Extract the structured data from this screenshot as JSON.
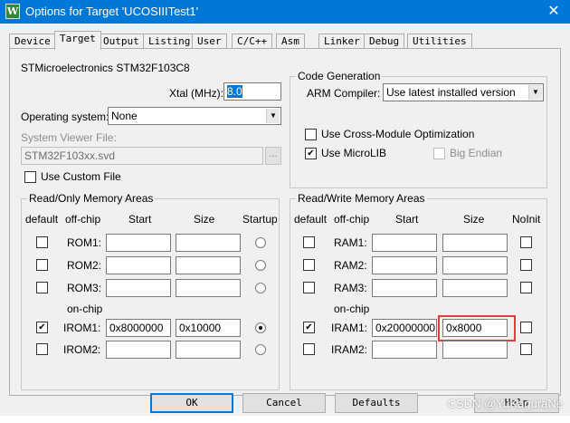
{
  "window": {
    "title": "Options for Target 'UCOSIIITest1'",
    "close_glyph": "✕",
    "app_icon_letter": "W"
  },
  "tabs": [
    "Device",
    "Target",
    "Output",
    "Listing",
    "User",
    "C/C++",
    "Asm",
    "Linker",
    "Debug",
    "Utilities"
  ],
  "active_tab": "Target",
  "device_name": "STMicroelectronics STM32F103C8",
  "xtal": {
    "label": "Xtal (MHz):",
    "value": "8.0"
  },
  "operating_system": {
    "label": "Operating system:",
    "value": "None"
  },
  "system_viewer": {
    "label": "System Viewer File:",
    "value": "STM32F103xx.svd",
    "browse_label": "..."
  },
  "use_custom_file": {
    "label": "Use Custom File",
    "checked": false
  },
  "code_generation": {
    "title": "Code Generation",
    "arm_compiler_label": "ARM Compiler:",
    "arm_compiler_value": "Use latest installed version",
    "cross_module": {
      "label": "Use Cross-Module Optimization",
      "checked": false
    },
    "microlib": {
      "label": "Use MicroLIB",
      "checked": true
    },
    "big_endian": {
      "label": "Big Endian",
      "checked": false,
      "disabled": true
    }
  },
  "rom_areas": {
    "title": "Read/Only Memory Areas",
    "headers": {
      "default": "default",
      "offchip": "off-chip",
      "start": "Start",
      "size": "Size",
      "startup": "Startup"
    },
    "onchip_label": "on-chip",
    "rows": [
      {
        "name": "ROM1:",
        "start": "",
        "size": "",
        "default": false,
        "startup": false
      },
      {
        "name": "ROM2:",
        "start": "",
        "size": "",
        "default": false,
        "startup": false
      },
      {
        "name": "ROM3:",
        "start": "",
        "size": "",
        "default": false,
        "startup": false
      },
      {
        "name": "IROM1:",
        "start": "0x8000000",
        "size": "0x10000",
        "default": true,
        "startup": true
      },
      {
        "name": "IROM2:",
        "start": "",
        "size": "",
        "default": false,
        "startup": false
      }
    ]
  },
  "ram_areas": {
    "title": "Read/Write Memory Areas",
    "headers": {
      "default": "default",
      "offchip": "off-chip",
      "start": "Start",
      "size": "Size",
      "noinit": "NoInit"
    },
    "onchip_label": "on-chip",
    "rows": [
      {
        "name": "RAM1:",
        "start": "",
        "size": "",
        "default": false,
        "noinit": false
      },
      {
        "name": "RAM2:",
        "start": "",
        "size": "",
        "default": false,
        "noinit": false
      },
      {
        "name": "RAM3:",
        "start": "",
        "size": "",
        "default": false,
        "noinit": false
      },
      {
        "name": "IRAM1:",
        "start": "0x20000000",
        "size": "0x8000",
        "default": true,
        "noinit": false
      },
      {
        "name": "IRAM2:",
        "start": "",
        "size": "",
        "default": false,
        "noinit": false
      }
    ]
  },
  "buttons": {
    "ok": "OK",
    "cancel": "Cancel",
    "defaults": "Defaults",
    "help": "Help"
  },
  "watermark": "CSDN @YuKaguraNe",
  "colors": {
    "titlebar": "#0078d7",
    "highlight": "#e63b3b"
  }
}
